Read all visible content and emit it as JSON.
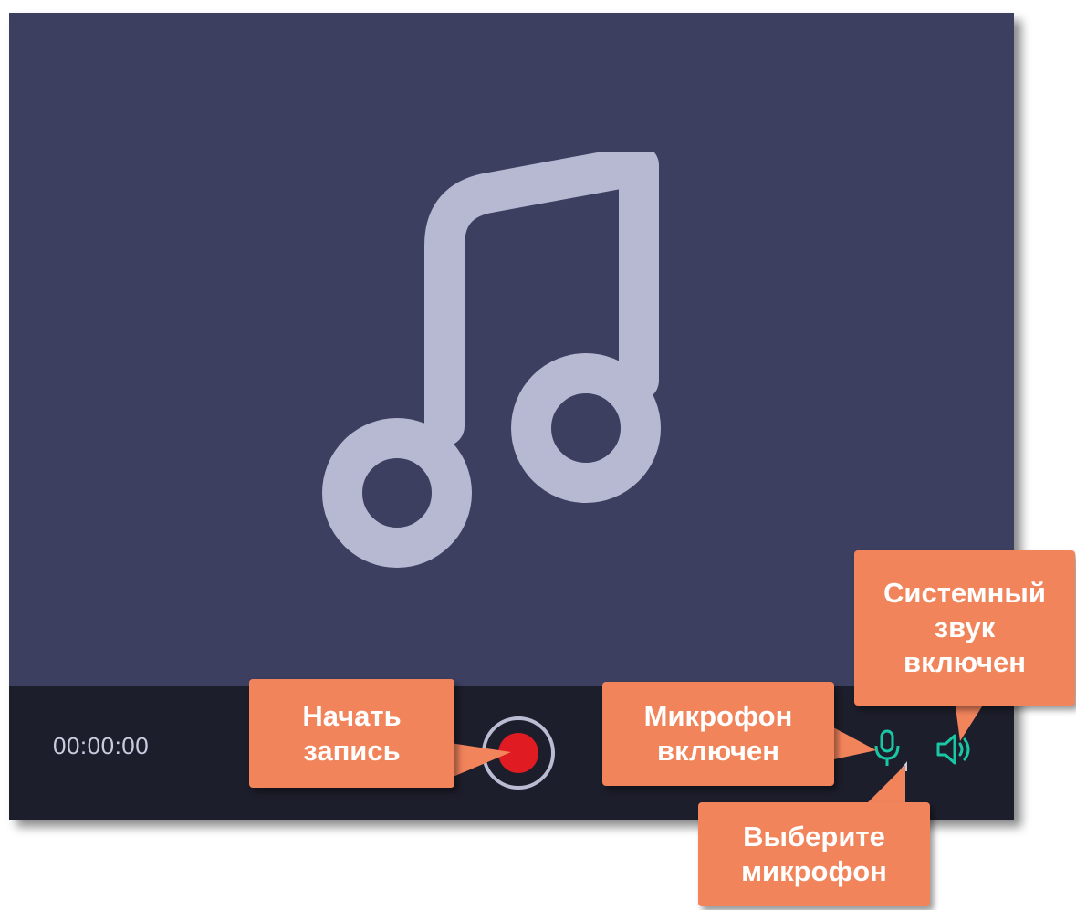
{
  "recorder": {
    "timer": "00:00:00",
    "preview_icon": "music-note-icon",
    "record_icon": "record-icon",
    "mic_icon": "microphone-icon",
    "speaker_icon": "speaker-icon"
  },
  "callouts": {
    "start_recording": "Начать\nзапись",
    "mic_on": "Микрофон\nвключен",
    "system_sound_on": "Системный\nзвук\nвключен",
    "choose_mic": "Выберите\nмикрофон"
  },
  "colors": {
    "preview_bg": "#3c3f5f",
    "toolbar_bg": "#1d1e2b",
    "icon_fill": "#b6b9d1",
    "record_red": "#e11b22",
    "accent_teal": "#19c7a4",
    "callout_bg": "#f2845c"
  }
}
